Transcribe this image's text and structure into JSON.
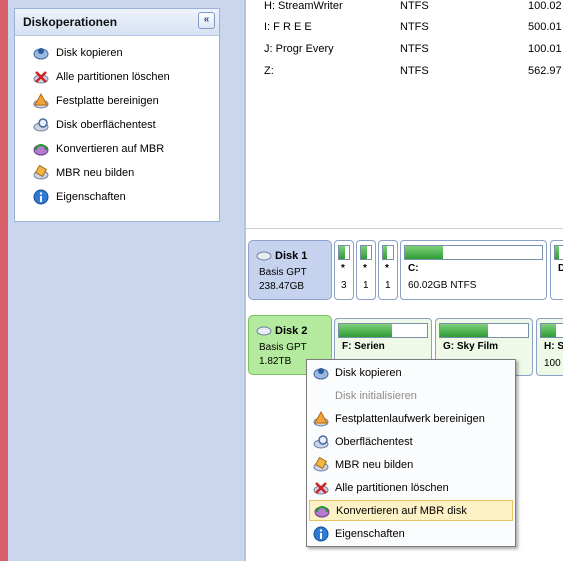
{
  "left_panel": {
    "title": "Diskoperationen",
    "collapse_glyph": "«",
    "items": [
      {
        "label": "Disk kopieren",
        "icon": "copy-disk-icon"
      },
      {
        "label": "Alle partitionen löschen",
        "icon": "delete-partitions-icon"
      },
      {
        "label": "Festplatte bereinigen",
        "icon": "wipe-disk-icon"
      },
      {
        "label": "Disk oberflächentest",
        "icon": "surface-test-icon"
      },
      {
        "label": "Konvertieren auf MBR",
        "icon": "convert-mbr-icon"
      },
      {
        "label": "MBR neu bilden",
        "icon": "rebuild-mbr-icon"
      },
      {
        "label": "Eigenschaften",
        "icon": "info-icon"
      }
    ]
  },
  "volume_list": [
    {
      "name": "H: StreamWriter",
      "fs": "NTFS",
      "size": "100.02"
    },
    {
      "name": "I: F R E E",
      "fs": "NTFS",
      "size": "500.01"
    },
    {
      "name": "J: Progr Every",
      "fs": "NTFS",
      "size": "100.01"
    },
    {
      "name": "Z:",
      "fs": "NTFS",
      "size": "562.97"
    }
  ],
  "disk_map": {
    "disk1": {
      "name": "Disk 1",
      "type": "Basis GPT",
      "size": "238.47GB",
      "partitions": [
        {
          "label": "*",
          "sub": "3",
          "fill": 0.6
        },
        {
          "label": "*",
          "sub": "1",
          "fill": 0.55
        },
        {
          "label": "*",
          "sub": "1",
          "fill": 0.4
        },
        {
          "label": "C:",
          "sub": "60.02GB NTFS",
          "fill": 0.3
        },
        {
          "label": "D",
          "sub": "",
          "fill": 0.2
        }
      ]
    },
    "disk2": {
      "name": "Disk 2",
      "type": "Basis GPT",
      "size": "1.82TB",
      "partitions": [
        {
          "label": "F: Serien",
          "fill": 0.6
        },
        {
          "label": "G: Sky Film",
          "fill": 0.55
        },
        {
          "label": "H: S",
          "sub": "100",
          "fill": 0.5
        }
      ]
    }
  },
  "context_menu": {
    "items": [
      {
        "label": "Disk kopieren",
        "icon": "copy-disk-icon",
        "state": "normal"
      },
      {
        "label": "Disk initialisieren",
        "icon": "",
        "state": "disabled"
      },
      {
        "label": "Festplattenlaufwerk bereinigen",
        "icon": "wipe-disk-icon",
        "state": "normal"
      },
      {
        "label": "Oberflächentest",
        "icon": "surface-test-icon",
        "state": "normal"
      },
      {
        "label": "MBR neu bilden",
        "icon": "rebuild-mbr-icon",
        "state": "normal"
      },
      {
        "label": "Alle partitionen löschen",
        "icon": "delete-partitions-icon",
        "state": "normal"
      },
      {
        "label": "Konvertieren auf MBR disk",
        "icon": "convert-mbr-icon",
        "state": "highlighted"
      },
      {
        "label": "Eigenschaften",
        "icon": "info-icon",
        "state": "normal"
      }
    ]
  },
  "colors": {
    "disk1_header": "#c6d3ee",
    "disk2_header": "#b4ea9e",
    "menu_highlight": "#fdf1c6",
    "left_accent": "#d8606a"
  }
}
